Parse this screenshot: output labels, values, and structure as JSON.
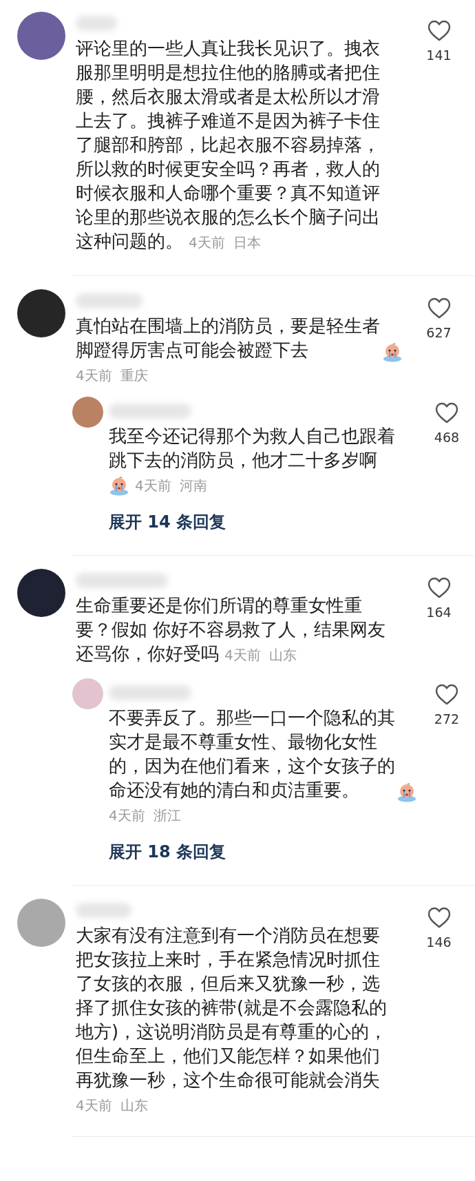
{
  "comments": [
    {
      "color": "#6b5f9e",
      "text": "评论里的一些人真让我长见识了。拽衣服那里明明是想拉住他的胳膊或者把住腰，然后衣服太滑或者是太松所以才滑上去了。拽裤子难道不是因为裤子卡住了腿部和胯部，比起衣服不容易掉落，所以救的时候更安全吗？再者，救人的时候衣服和人命哪个重要？真不知道评论里的那些说衣服的怎么长个脑子问出这种问题的。",
      "time": "4天前",
      "location": "日本",
      "meta_inline": true,
      "likes": "141"
    },
    {
      "color": "#262626",
      "text": "真怕站在围墙上的消防员，要是轻生者脚蹬得厉害点可能会被蹬下去",
      "emoji_after_text": true,
      "time": "4天前",
      "location": "重庆",
      "meta_inline": false,
      "likes": "627",
      "replies": [
        {
          "color": "#b98263",
          "text": "我至今还记得那个为救人自己也跟着跳下去的消防员，他才二十多岁啊",
          "emoji_before_time": true,
          "time": "4天前",
          "location": "河南",
          "meta_inline": false,
          "likes": "468"
        }
      ],
      "expand_label": "展开 14 条回复"
    },
    {
      "color": "#1f2233",
      "text": "生命重要还是你们所谓的尊重女性重要？假如 你好不容易救了人，结果网友还骂你，你好受吗",
      "time": "4天前",
      "location": "山东",
      "meta_inline": true,
      "likes": "164",
      "replies": [
        {
          "color": "#e3c3cf",
          "text": "不要弄反了。那些一口一个隐私的其实才是最不尊重女性、最物化女性的，因为在他们看来，这个女孩子的命还没有她的清白和贞洁重要。",
          "emoji_after_text": true,
          "time": "4天前",
          "location": "浙江",
          "meta_inline": false,
          "likes": "272"
        }
      ],
      "expand_label": "展开 18 条回复"
    },
    {
      "color": "#a9a9a9",
      "text": "大家有没有注意到有一个消防员在想要把女孩拉上来时，手在紧急情况时抓住了女孩的衣服，但后来又犹豫一秒，选择了抓住女孩的裤带(就是不会露隐私的地方)，这说明消防员是有尊重的心的，但生命至上，他们又能怎样？如果他们再犹豫一秒，这个生命很可能就会消失",
      "time": "4天前",
      "location": "山东",
      "meta_inline": false,
      "likes": "146"
    }
  ]
}
